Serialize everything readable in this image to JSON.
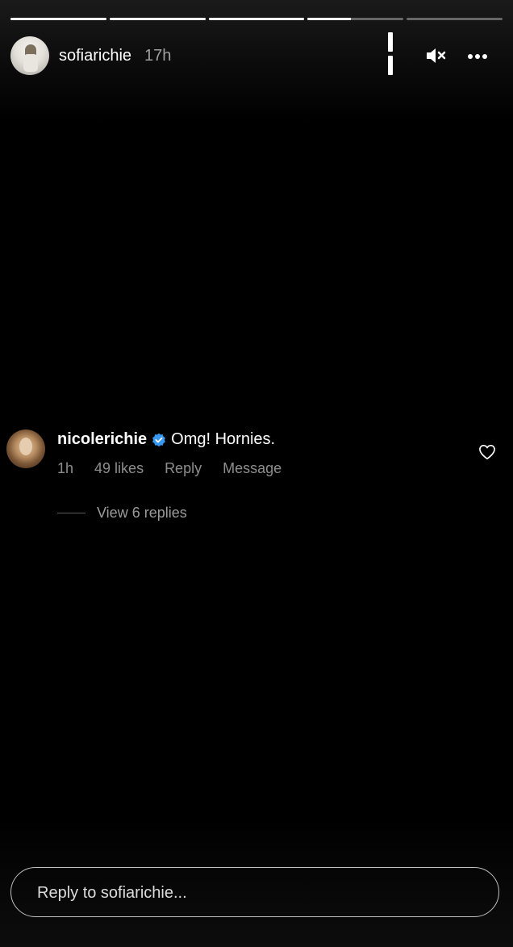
{
  "story": {
    "progress": [
      1,
      1,
      1,
      0.45,
      0
    ],
    "username": "sofiarichie",
    "posted_ago": "17h"
  },
  "controls": {
    "pause_icon": "pause-icon",
    "mute_icon": "volume-muted-icon",
    "more_icon": "more-horizontal-icon"
  },
  "comment": {
    "username": "nicolerichie",
    "verified_icon": "verified-badge-icon",
    "text": "Omg! Hornies.",
    "time": "1h",
    "likes": "49 likes",
    "reply_label": "Reply",
    "message_label": "Message",
    "view_replies": "View 6 replies",
    "heart_icon": "heart-outline-icon"
  },
  "reply_input": {
    "placeholder": "Reply to sofiarichie..."
  },
  "colors": {
    "background": "#000000",
    "verified_blue": "#3897f0"
  }
}
